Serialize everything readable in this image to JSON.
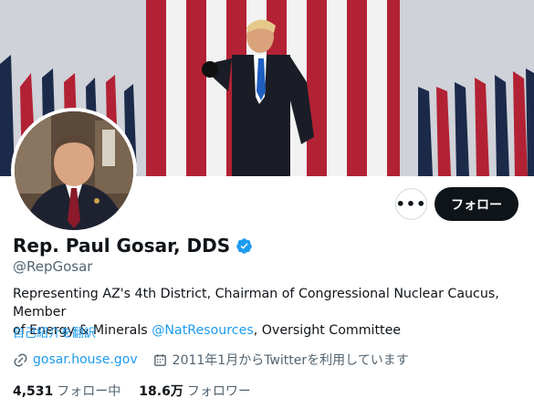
{
  "profile": {
    "display_name": "Rep. Paul Gosar, DDS",
    "handle": "@RepGosar",
    "bio_line1": "Representing AZ's 4th District, Chairman of Congressional Nuclear Caucus, Member",
    "bio_line2_prefix": "of Energy & Minerals ",
    "bio_mention": "@NatResources",
    "bio_line2_suffix": ", Oversight Committee",
    "translate_label": "自己紹介を翻訳",
    "website": "gosar.house.gov",
    "joined": "2011年1月からTwitterを利用しています",
    "following_count": "4,531",
    "following_label": "フォロー中",
    "followers_count": "18.6万",
    "followers_label": "フォロワー"
  },
  "actions": {
    "more_label": "•••",
    "follow_label": "フォロー"
  },
  "colors": {
    "accent": "#1d9bf0",
    "follow_button": "#0f1419",
    "secondary_text": "#536471"
  },
  "icons": {
    "verified": "verified-badge-icon",
    "link": "link-icon",
    "calendar": "calendar-icon",
    "more": "more-options-icon"
  }
}
